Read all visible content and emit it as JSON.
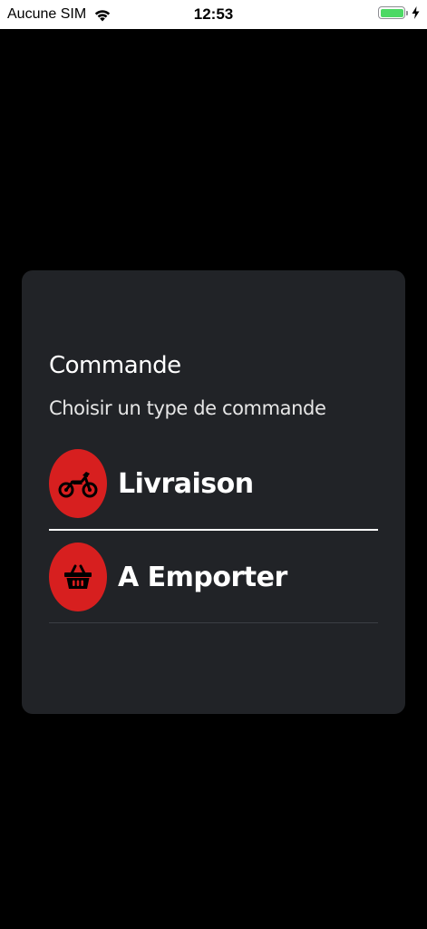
{
  "status_bar": {
    "carrier": "Aucune SIM",
    "time": "12:53",
    "wifi_icon": "wifi-icon",
    "battery_icon": "battery-icon",
    "charging_icon": "bolt-icon",
    "battery_level": 1.0,
    "battery_color": "#4cd964"
  },
  "dialog": {
    "title": "Commande",
    "subtitle": "Choisir un type de commande",
    "background": "#212327",
    "options": [
      {
        "label": "Livraison",
        "icon": "motorcycle-icon",
        "icon_bg": "#d71f1f"
      },
      {
        "label": "A Emporter",
        "icon": "basket-icon",
        "icon_bg": "#d71f1f"
      }
    ]
  }
}
